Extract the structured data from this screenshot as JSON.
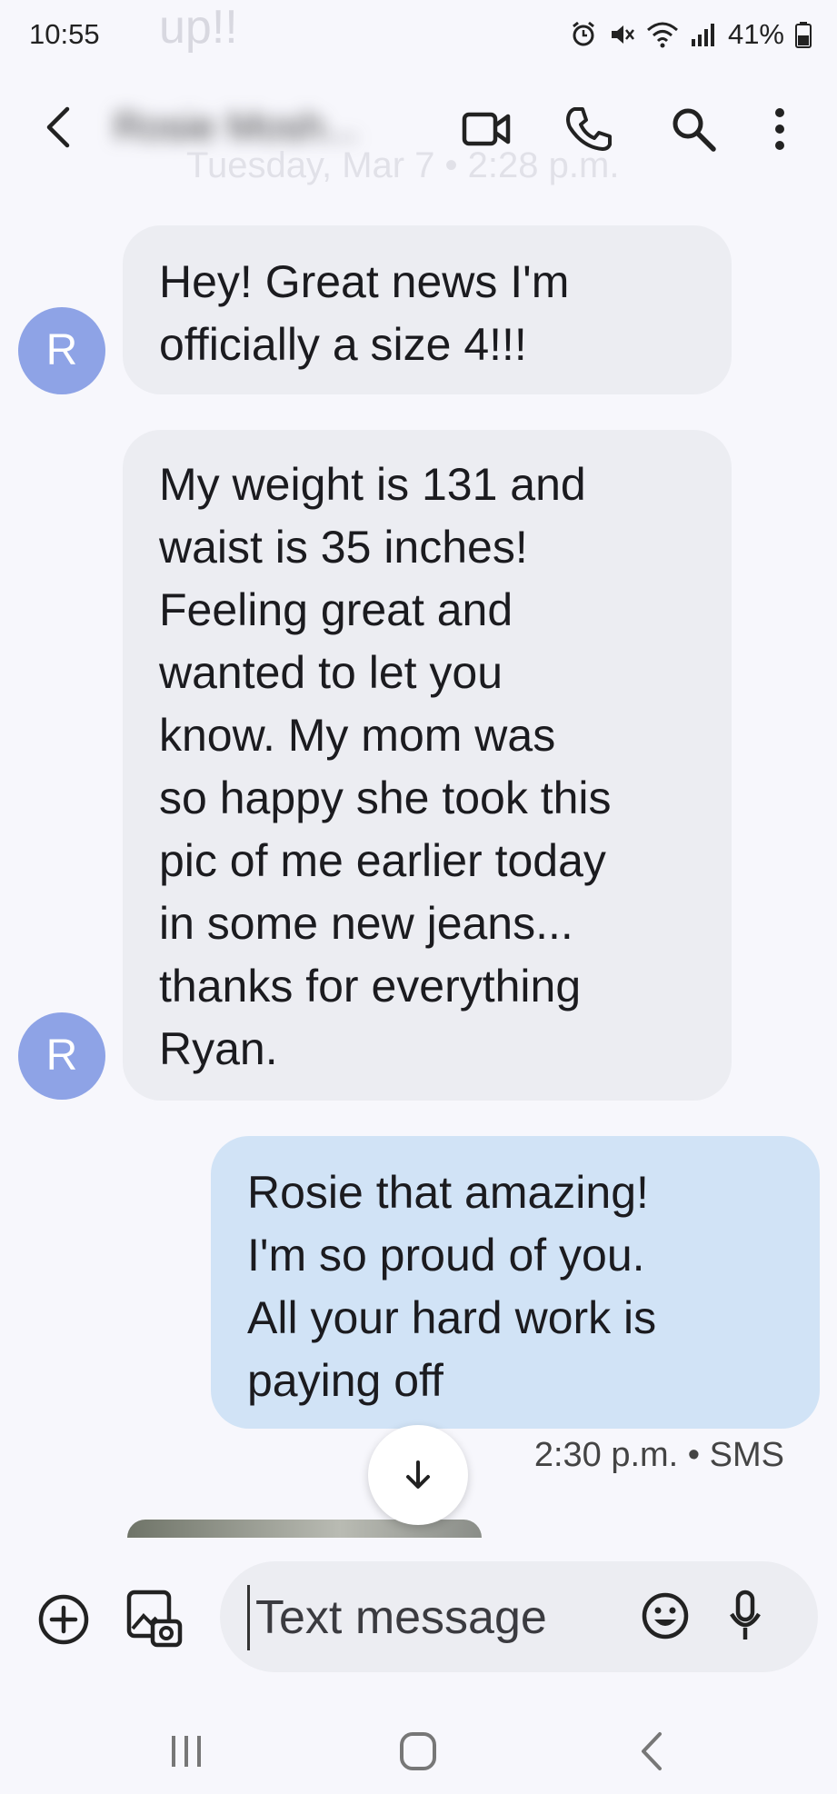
{
  "status_bar": {
    "time": "10:55",
    "background_text": "up!!",
    "battery_percent": "41%"
  },
  "header": {
    "contact_name": "Rosie Mosh...",
    "date_label": "Tuesday, Mar 7 • 2:28 p.m."
  },
  "messages": [
    {
      "direction": "incoming",
      "avatar": "R",
      "text": "Hey! Great news I'm\nofficially a size 4!!!"
    },
    {
      "direction": "incoming",
      "avatar": "R",
      "text": "My weight is 131 and\nwaist is 35 inches!\nFeeling great and\nwanted to let you\nknow. My mom was\nso happy she took this\npic of me earlier today\nin some new jeans...\nthanks for everything\nRyan."
    },
    {
      "direction": "outgoing",
      "text": "Rosie that amazing!\nI'm so proud of you.\nAll your hard work is\npaying off"
    }
  ],
  "last_message_meta": "2:30 p.m. • SMS",
  "composer": {
    "placeholder": "Text message"
  },
  "colors": {
    "incoming_bubble": "#ecedf2",
    "outgoing_bubble": "#d1e3f6",
    "avatar": "#8ea3e6"
  },
  "icons": {
    "status": [
      "alarm-icon",
      "mute-icon",
      "wifi-icon",
      "signal-icon",
      "battery-icon"
    ],
    "header": [
      "back-icon",
      "video-call-icon",
      "phone-icon",
      "search-icon",
      "more-options-icon"
    ],
    "composer": [
      "add-icon",
      "gallery-icon",
      "emoji-icon",
      "mic-icon"
    ],
    "nav": [
      "recents-icon",
      "home-icon",
      "nav-back-icon"
    ]
  }
}
